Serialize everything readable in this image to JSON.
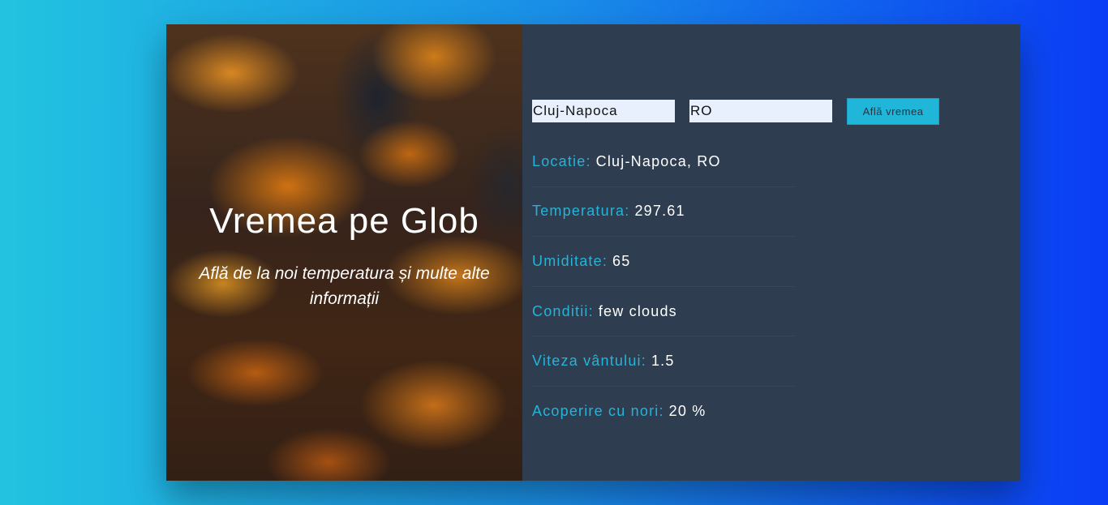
{
  "hero": {
    "title": "Vremea pe Glob",
    "subtitle": "Află de la noi temperatura și multe alte informații"
  },
  "form": {
    "city_value": "Cluj-Napoca",
    "country_value": "RO",
    "submit_label": "Află vremea"
  },
  "info": [
    {
      "label": "Locatie:",
      "value": "Cluj-Napoca, RO"
    },
    {
      "label": "Temperatura:",
      "value": "297.61"
    },
    {
      "label": "Umiditate:",
      "value": "65"
    },
    {
      "label": "Conditii:",
      "value": "few clouds"
    },
    {
      "label": "Viteza vântului:",
      "value": "1.5"
    },
    {
      "label": "Acoperire cu nori:",
      "value": "20 %"
    }
  ],
  "colors": {
    "accent": "#25b4d8",
    "panel": "#2e3d50",
    "button": "#20b6d9"
  }
}
